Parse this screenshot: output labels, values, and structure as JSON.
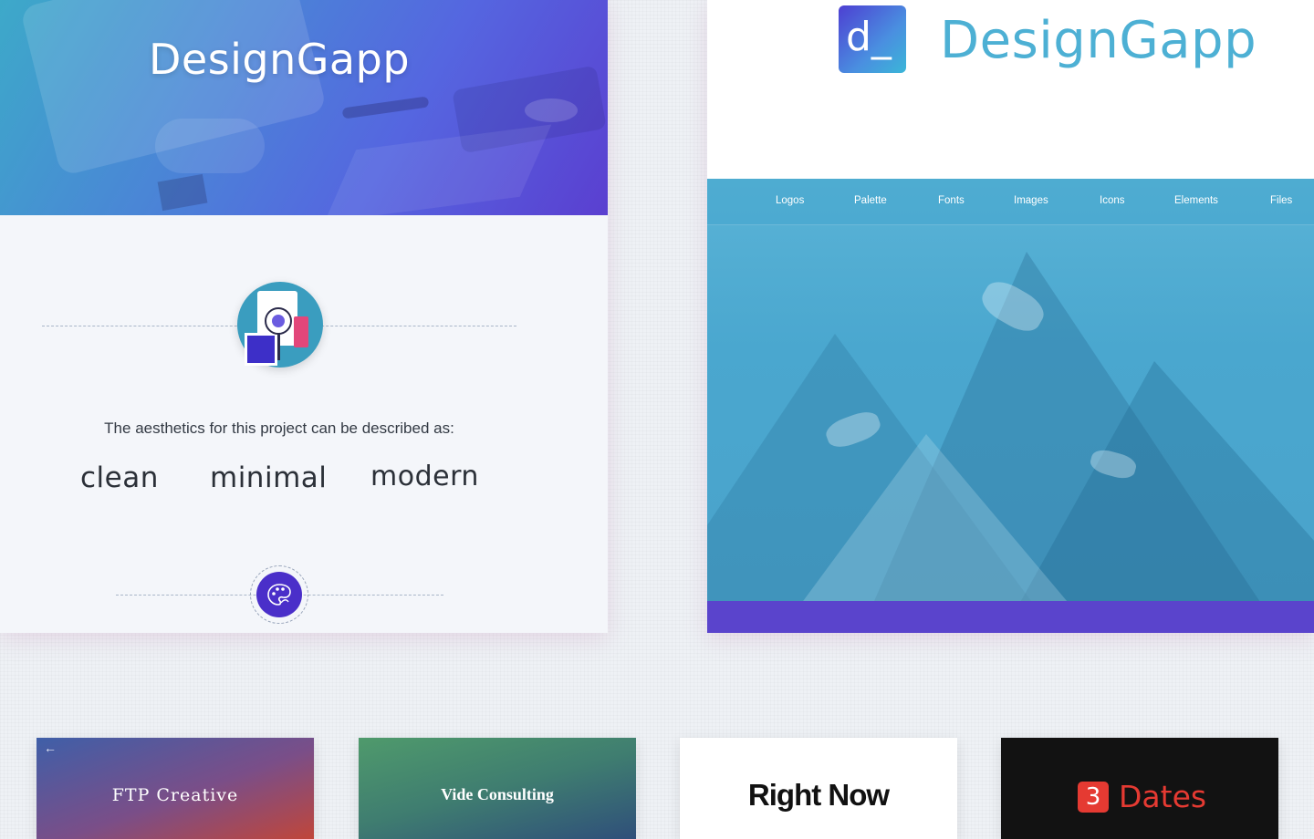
{
  "left_card": {
    "hero_title": "DesignGapp",
    "aesthetics_intro": "The aesthetics for this project can be described as:",
    "words": [
      "clean",
      "minimal",
      "modern"
    ],
    "emblem_icon": "design-tools-icon",
    "palette_icon": "palette-icon"
  },
  "right_card": {
    "logo_letter": "d_",
    "brand_title": "DesignGapp",
    "nav": [
      "Logos",
      "Palette",
      "Fonts",
      "Images",
      "Icons",
      "Elements",
      "Files"
    ],
    "hero_image": "mountain-range",
    "footer_color": "#5a44cc",
    "accent_color": "#4db0d4"
  },
  "thumbnails": [
    {
      "title": "FTP Creative",
      "back_icon": "←"
    },
    {
      "title": "Vide Consulting"
    },
    {
      "title": "Right Now"
    },
    {
      "badge": "3",
      "title": "Dates",
      "accent": "#e53a32"
    }
  ]
}
